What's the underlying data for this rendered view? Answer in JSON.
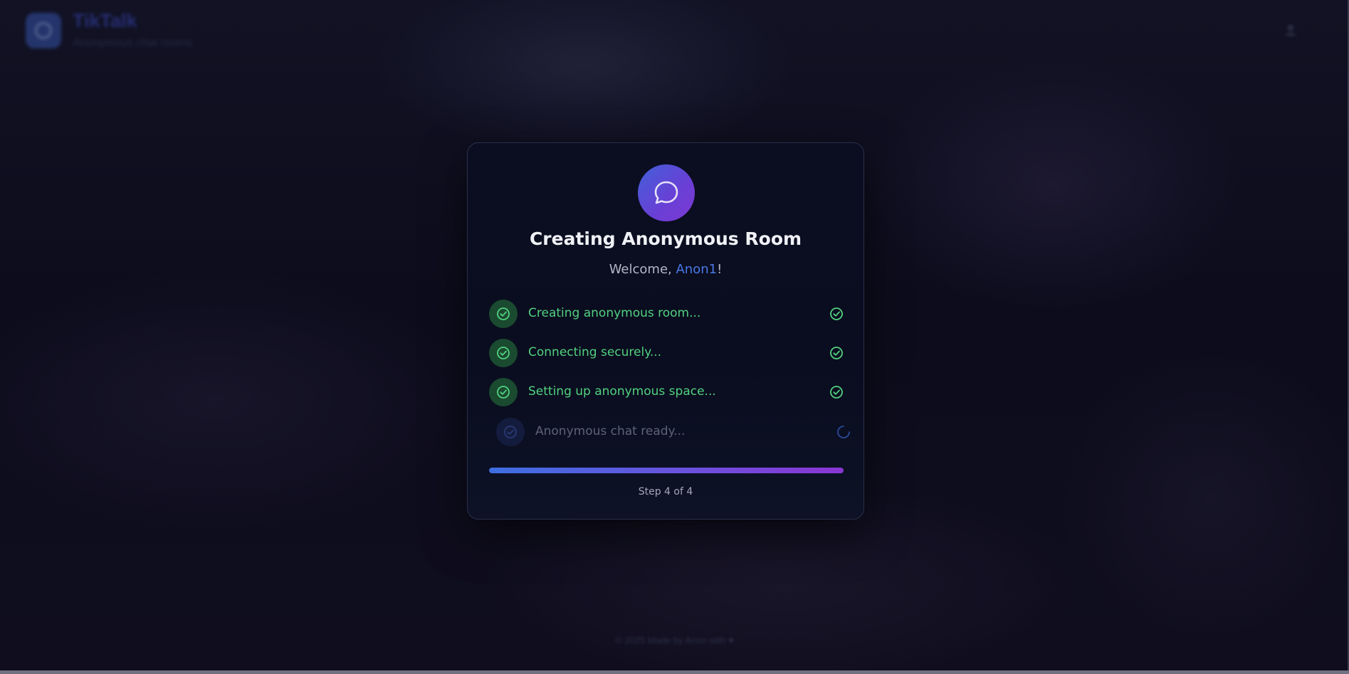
{
  "header": {
    "brand_name": "TikTalk",
    "brand_tagline": "Anonymous chat rooms"
  },
  "footer": {
    "text": "© 2025 Made by Anon with ♥"
  },
  "card": {
    "title": "Creating Anonymous Room",
    "welcome_prefix": "Welcome, ",
    "username": "Anon1",
    "welcome_suffix": "!",
    "steps": [
      {
        "label": "Creating anonymous room...",
        "status": "done"
      },
      {
        "label": "Connecting securely...",
        "status": "done"
      },
      {
        "label": "Setting up anonymous space...",
        "status": "done"
      },
      {
        "label": "Anonymous chat ready...",
        "status": "in-progress"
      }
    ],
    "progress_percent": 100,
    "step_counter": "Step 4 of 4"
  },
  "colors": {
    "accent_blue": "#4a78e8",
    "accent_purple": "#7c39d2",
    "success_green": "#52d17f",
    "pending_gray": "#5e6278"
  },
  "icons": {
    "card_icon": "chat-bubble-icon",
    "step_done": "check-circle-icon",
    "step_pending": "spinner-icon"
  }
}
